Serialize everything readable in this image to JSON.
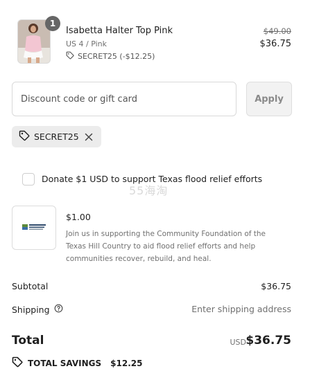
{
  "product": {
    "quantity": "1",
    "name": "Isabetta Halter Top Pink",
    "variant": "US 4 / Pink",
    "discount_line": "SECRET25 (-$12.25)",
    "original_price": "$49.00",
    "price": "$36.75"
  },
  "discount": {
    "placeholder": "Discount code or gift card",
    "apply_label": "Apply",
    "applied_code": "SECRET25"
  },
  "donate": {
    "label": "Donate $1 USD to support Texas flood relief efforts",
    "checked": false,
    "amount": "$1.00",
    "description": "Join us in supporting the Community Foundation of the Texas Hill Country to aid flood relief efforts and help communities recover, rebuild, and heal."
  },
  "watermark": "55海淘",
  "summary": {
    "subtotal_label": "Subtotal",
    "subtotal_value": "$36.75",
    "shipping_label": "Shipping",
    "shipping_value": "Enter shipping address",
    "total_label": "Total",
    "currency": "USD",
    "total_value": "$36.75",
    "savings_label": "TOTAL SAVINGS",
    "savings_value": "$12.25"
  },
  "colors": {
    "text": "#1f1f1f",
    "muted": "#707070",
    "badge": "#666666",
    "chip_bg": "#ececec",
    "apply_bg": "#f2f2f2"
  }
}
